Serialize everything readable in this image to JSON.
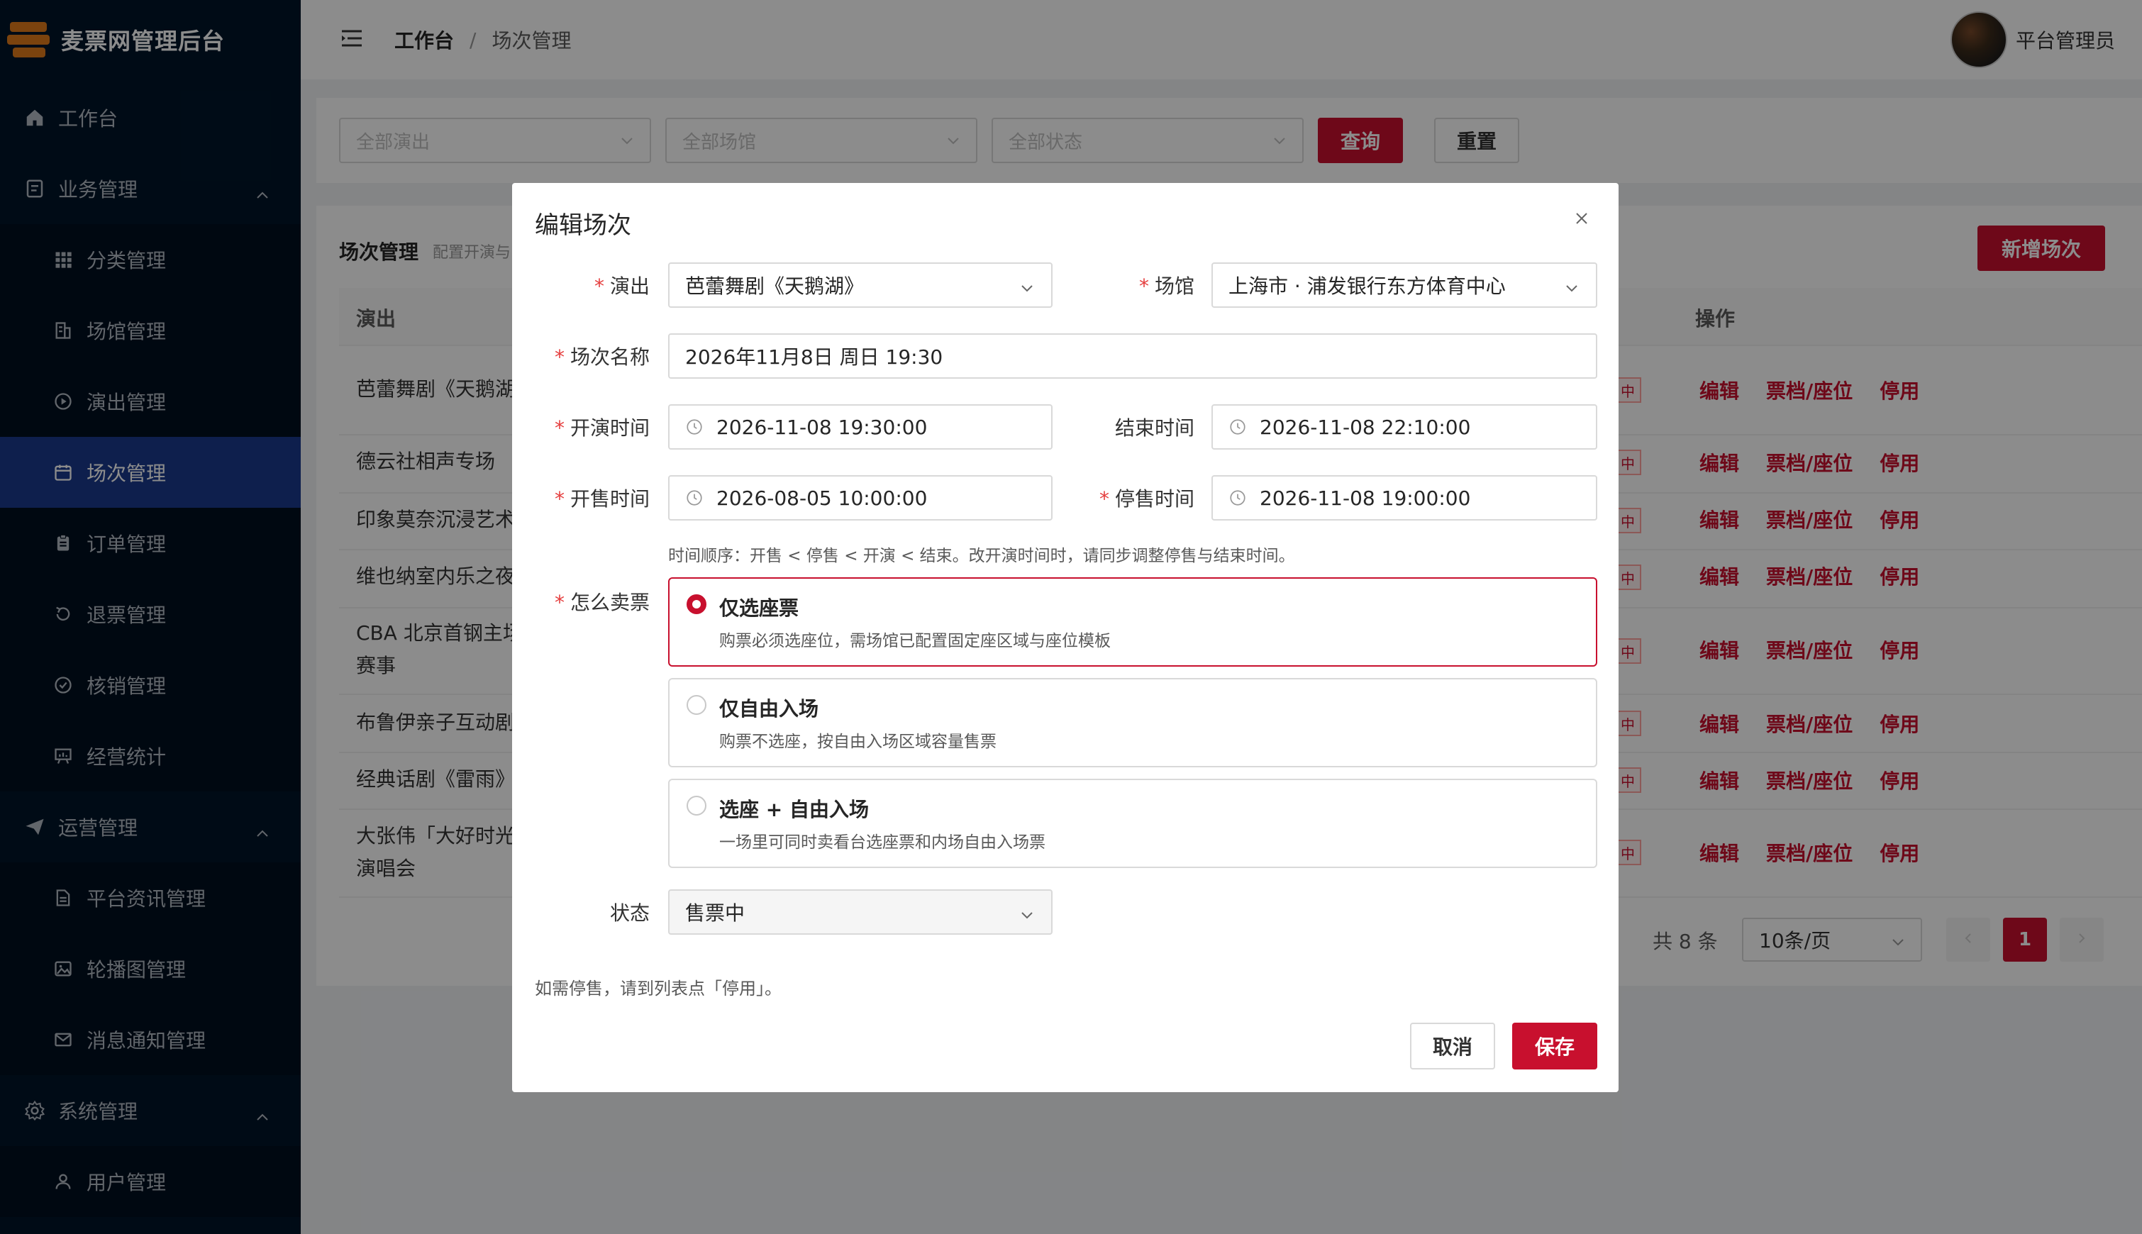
{
  "app": {
    "title": "麦票网管理后台"
  },
  "sidebar": {
    "items": [
      {
        "label": "工作台",
        "icon": "home-icon"
      },
      {
        "label": "业务管理",
        "icon": "document-icon"
      },
      {
        "label": "分类管理",
        "icon": "grid-icon"
      },
      {
        "label": "场馆管理",
        "icon": "building-icon"
      },
      {
        "label": "演出管理",
        "icon": "play-circle-icon"
      },
      {
        "label": "场次管理",
        "icon": "calendar-icon"
      },
      {
        "label": "订单管理",
        "icon": "clipboard-icon"
      },
      {
        "label": "退票管理",
        "icon": "refresh-icon"
      },
      {
        "label": "核销管理",
        "icon": "check-circle-icon"
      },
      {
        "label": "经营统计",
        "icon": "chart-board-icon"
      },
      {
        "label": "运营管理",
        "icon": "send-icon"
      },
      {
        "label": "平台资讯管理",
        "icon": "file-icon"
      },
      {
        "label": "轮播图管理",
        "icon": "image-icon"
      },
      {
        "label": "消息通知管理",
        "icon": "mail-icon"
      },
      {
        "label": "系统管理",
        "icon": "gear-icon"
      },
      {
        "label": "用户管理",
        "icon": "user-icon"
      }
    ]
  },
  "header": {
    "breadcrumb_home": "工作台",
    "breadcrumb_sep": "/",
    "breadcrumb_current": "场次管理",
    "user_name": "平台管理员"
  },
  "filters": {
    "show_placeholder": "全部演出",
    "venue_placeholder": "全部场馆",
    "status_placeholder": "全部状态",
    "query_label": "查询",
    "reset_label": "重置"
  },
  "table": {
    "title": "场次管理",
    "subtitle": "配置开演与",
    "add_label": "新增场次",
    "columns": {
      "show": "演出",
      "actions": "操作"
    },
    "status_fragment": "中",
    "actions": {
      "edit": "编辑",
      "tickets": "票档/座位",
      "disable": "停用"
    },
    "rows": [
      {
        "show_line1": "芭蕾舞剧《天鹅湖",
        "show_line2": ""
      },
      {
        "show_line1": "德云社相声专场",
        "show_line2": ""
      },
      {
        "show_line1": "印象莫奈沉浸艺术",
        "show_line2": ""
      },
      {
        "show_line1": "维也纳室内乐之夜",
        "show_line2": ""
      },
      {
        "show_line1": "CBA 北京首钢主场",
        "show_line2": "赛事"
      },
      {
        "show_line1": "布鲁伊亲子互动剧",
        "show_line2": ""
      },
      {
        "show_line1": "经典话剧《雷雨》",
        "show_line2": ""
      },
      {
        "show_line1": "大张伟「大好时光",
        "show_line2": "演唱会"
      }
    ],
    "total": "共 8 条",
    "page_size": "10条/页",
    "current_page": "1"
  },
  "modal": {
    "title": "编辑场次",
    "show_label": "演出",
    "show_value": "芭蕾舞剧《天鹅湖》",
    "venue_label": "场馆",
    "venue_value": "上海市 · 浦发银行东方体育中心",
    "session_name_label": "场次名称",
    "session_name_value": "2026年11月8日 周日 19:30",
    "start_label": "开演时间",
    "start_value": "2026-11-08 19:30:00",
    "end_label": "结束时间",
    "end_value": "2026-11-08 22:10:00",
    "sale_start_label": "开售时间",
    "sale_start_value": "2026-08-05 10:00:00",
    "sale_stop_label": "停售时间",
    "sale_stop_value": "2026-11-08 19:00:00",
    "hint": "时间顺序：开售 < 停售 < 开演 < 结束。改开演时间时，请同步调整停售与结束时间。",
    "sell_mode_label": "怎么卖票",
    "sell_options": [
      {
        "title": "仅选座票",
        "desc": "购票必须选座位，需场馆已配置固定座区域与座位模板",
        "selected": true
      },
      {
        "title": "仅自由入场",
        "desc": "购票不选座，按自由入场区域容量售票",
        "selected": false
      },
      {
        "title": "选座 + 自由入场",
        "desc": "一场里可同时卖看台选座票和内场自由入场票",
        "selected": false
      }
    ],
    "status_label": "状态",
    "status_value": "售票中",
    "foot_note": "如需停售，请到列表点「停用」。",
    "cancel_label": "取消",
    "save_label": "保存"
  },
  "colors": {
    "brand": "#c8102e",
    "sidebar_bg": "#001529",
    "active_menu": "#1a3a8c"
  }
}
